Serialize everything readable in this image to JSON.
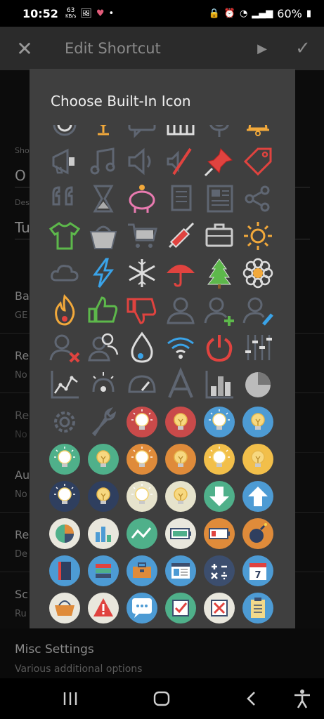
{
  "status_bar": {
    "time": "10:52",
    "net_speed_value": "63",
    "net_speed_unit": "KB/s",
    "battery_percent": "60%"
  },
  "app_bar": {
    "close_icon": "close-icon",
    "title": "Edit Shortcut",
    "play_icon": "play-icon",
    "confirm_icon": "check-icon"
  },
  "background_form": {
    "name_label": "Sho",
    "name_value": "O",
    "desc_label": "Des",
    "desc_value": "Tu",
    "rows": [
      {
        "title": "Ba",
        "subtitle": "GE"
      },
      {
        "title": "Re",
        "subtitle": "No"
      },
      {
        "title": "Re",
        "subtitle": "No"
      },
      {
        "title": "Au",
        "subtitle": "No"
      },
      {
        "title": "Re",
        "subtitle": "De"
      },
      {
        "title": "Sc",
        "subtitle": "Ru"
      }
    ]
  },
  "dialog": {
    "title": "Choose Built-In Icon",
    "icons": [
      "record-icon",
      "trophy-icon",
      "chat-bubble-icon",
      "piano-icon",
      "microphone-icon",
      "bell-icon",
      "megaphone-icon",
      "music-note-icon",
      "speaker-icon",
      "mute-icon",
      "pin-icon",
      "tag-icon",
      "quote-icon",
      "hourglass-icon",
      "piggy-bank-icon",
      "scroll-icon",
      "newspaper-icon",
      "share-icon",
      "shirt-icon",
      "basket-icon",
      "cart-icon",
      "syringe-icon",
      "briefcase-icon",
      "sun-icon",
      "cloud-icon",
      "lightning-icon",
      "snowflake-icon",
      "umbrella-icon",
      "tree-icon",
      "flower-icon",
      "fire-icon",
      "thumbs-up-icon",
      "thumbs-down-icon",
      "user-icon",
      "user-add-icon",
      "user-edit-icon",
      "user-remove-icon",
      "users-icon",
      "water-drop-icon",
      "wifi-icon",
      "power-icon",
      "equalizer-icon",
      "line-chart-icon",
      "dimmer-icon",
      "gauge-icon",
      "font-icon",
      "bar-chart-icon",
      "pie-chart-icon",
      "settings-gear-icon",
      "wrench-icon",
      "bulb-on-red-icon",
      "bulb-off-red-icon",
      "bulb-on-blue-icon",
      "bulb-off-blue-icon",
      "bulb-on-teal-icon",
      "bulb-off-teal-icon",
      "bulb-on-orange-icon",
      "bulb-off-orange-icon",
      "bulb-on-yellow-icon",
      "bulb-off-yellow-icon",
      "bulb-on-navy-icon",
      "bulb-off-navy-icon",
      "bulb-on-cream-icon",
      "bulb-off-cream-icon",
      "download-icon",
      "upload-icon",
      "pie-chart-circle-icon",
      "bar-chart-circle-icon",
      "line-chart-circle-icon",
      "battery-full-icon",
      "battery-low-icon",
      "bomb-icon",
      "notebook-icon",
      "books-icon",
      "toolbox-icon",
      "browser-window-icon",
      "calculator-icon",
      "calendar-icon",
      "shopping-basket-icon",
      "warning-icon",
      "speech-bubble-icon",
      "checkbox-checked-icon",
      "checkbox-crossed-icon",
      "clipboard-icon"
    ],
    "calendar_day": "7"
  },
  "misc_settings": {
    "title": "Misc Settings",
    "subtitle": "Various additional options"
  },
  "nav_bar": {
    "recents": "recents-icon",
    "home": "home-icon",
    "back": "back-icon",
    "accessibility": "accessibility-icon"
  }
}
